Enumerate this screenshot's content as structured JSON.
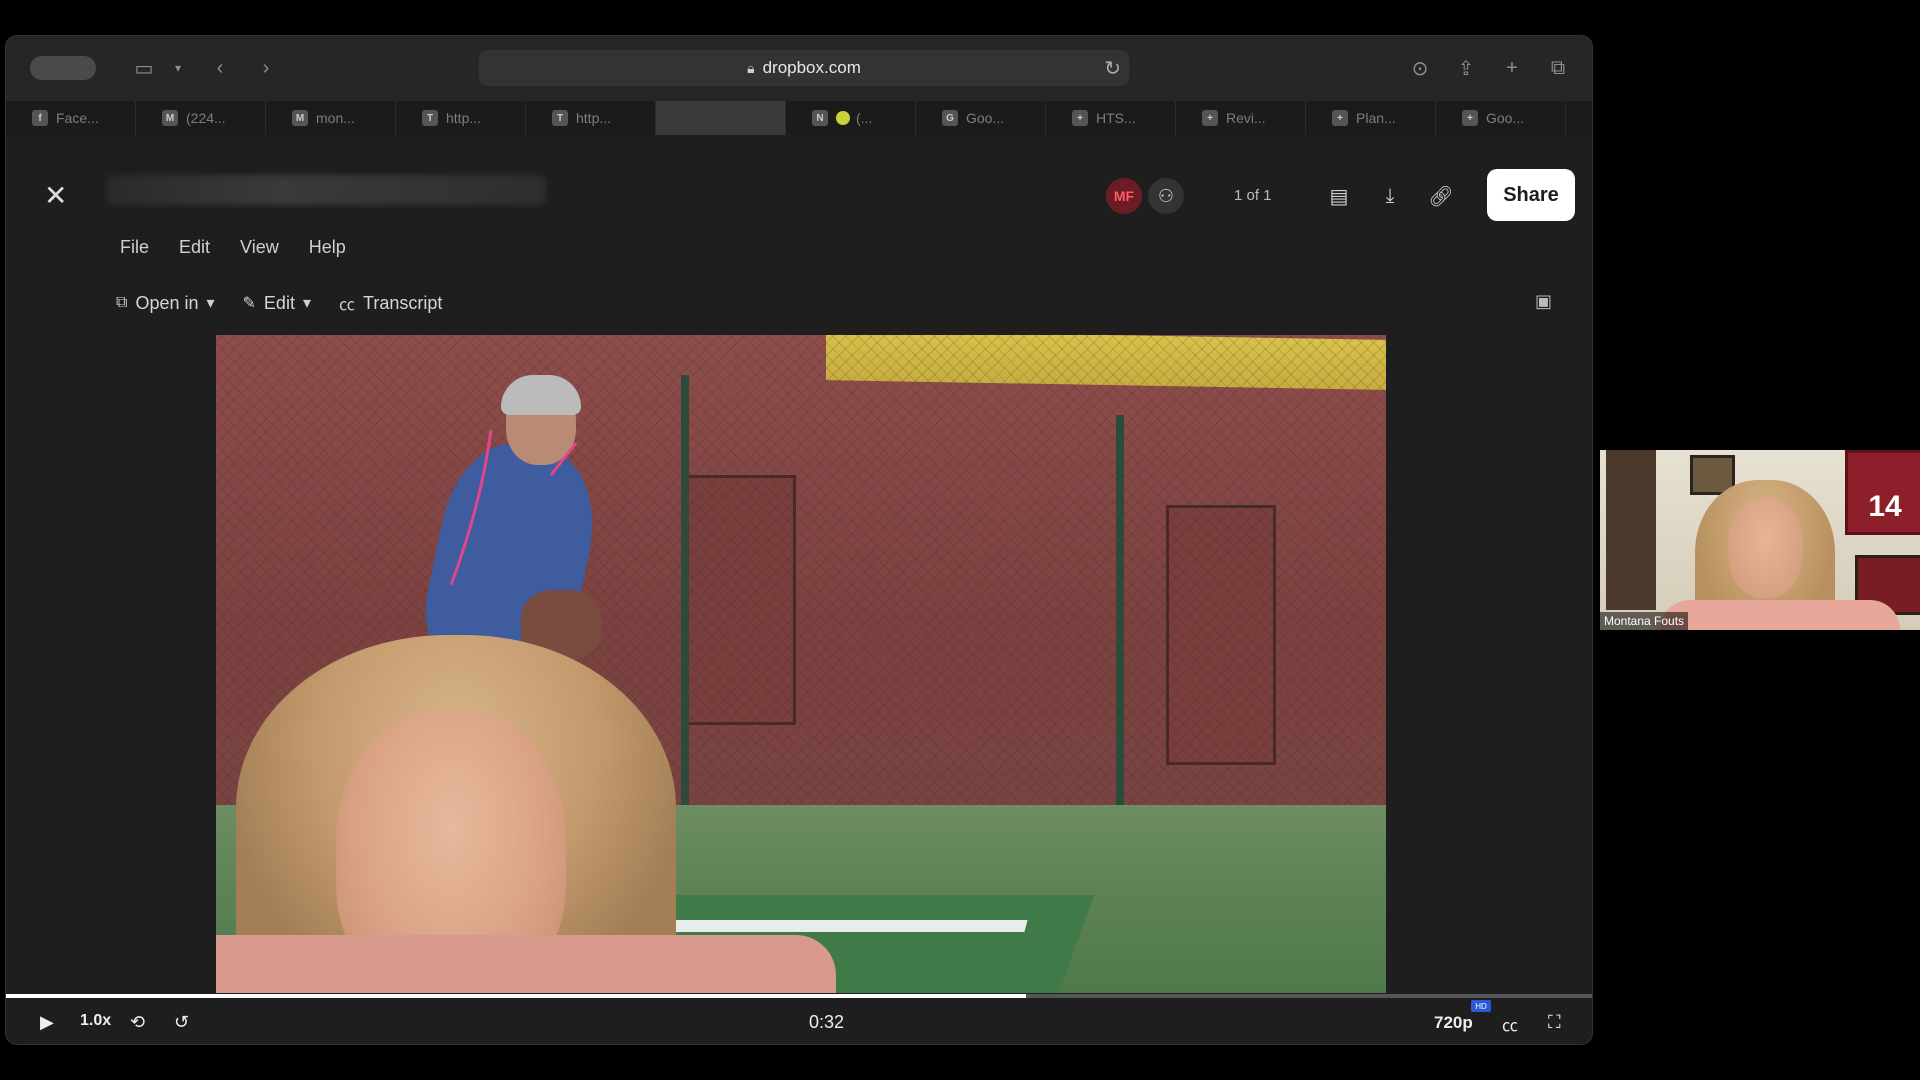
{
  "browser": {
    "url": "dropbox.com",
    "tabs": [
      {
        "label": "Face...",
        "favicon": "f"
      },
      {
        "label": "(224...",
        "favicon": "M"
      },
      {
        "label": "mon...",
        "favicon": "M"
      },
      {
        "label": "http...",
        "favicon": "T"
      },
      {
        "label": "http...",
        "favicon": "T"
      },
      {
        "label": "",
        "favicon": ""
      },
      {
        "label": "(...",
        "favicon": "N"
      },
      {
        "label": "Goo...",
        "favicon": "G"
      },
      {
        "label": "HTS...",
        "favicon": "+"
      },
      {
        "label": "Revi...",
        "favicon": "+"
      },
      {
        "label": "Plan...",
        "favicon": "+"
      },
      {
        "label": "Goo...",
        "favicon": "+"
      }
    ]
  },
  "app": {
    "menu": [
      "File",
      "Edit",
      "View",
      "Help"
    ],
    "avatar_initials": "MF",
    "pager": "1 of 1",
    "share_label": "Share",
    "subbar": {
      "open_in": "Open in",
      "edit": "Edit",
      "transcript": "Transcript"
    }
  },
  "player": {
    "speed": "1.0x",
    "time": "0:32",
    "quality": "720p",
    "hd_badge": "HD",
    "progress": 0.643
  },
  "webcam": {
    "name": "Montana Fouts",
    "jersey_number": "14"
  }
}
